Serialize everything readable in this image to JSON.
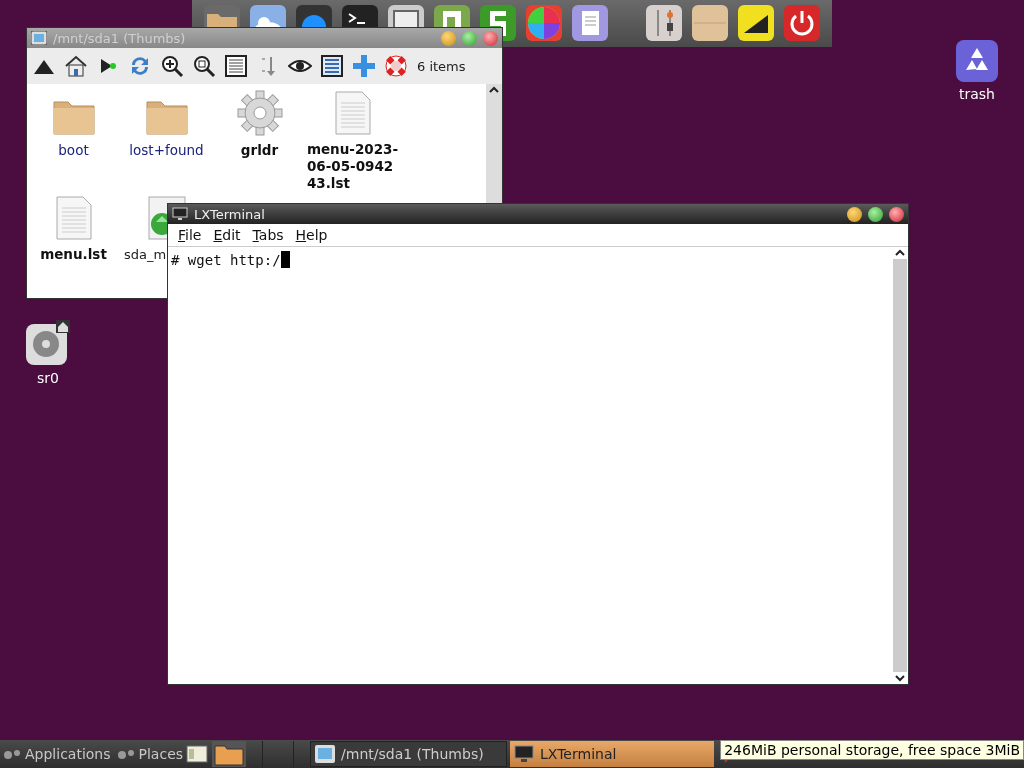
{
  "desktop_icons": [
    {
      "label": "trash",
      "kind": "trash"
    },
    {
      "label": "sr0",
      "kind": "drive"
    }
  ],
  "file_manager": {
    "title": "/mnt/sda1 (Thumbs)",
    "active": false,
    "status": "6 items",
    "files": [
      {
        "name": "boot",
        "kind": "folder"
      },
      {
        "name": "lost+found",
        "kind": "folder"
      },
      {
        "name": "grldr",
        "kind": "binary"
      },
      {
        "name": "menu-2023-\n06-05-0942\n43.lst",
        "kind": "text"
      },
      {
        "name": "menu.lst",
        "kind": "text"
      },
      {
        "name": "sda_m",
        "kind": "script"
      }
    ]
  },
  "terminal": {
    "title": "LXTerminal",
    "active": true,
    "menu": [
      {
        "label": "File"
      },
      {
        "label": "Edit"
      },
      {
        "label": "Tabs"
      },
      {
        "label": "Help"
      }
    ],
    "lines": [
      "# wget http:/"
    ]
  },
  "taskbar": {
    "launchers": [
      {
        "label": "Applications"
      },
      {
        "label": "Places"
      }
    ],
    "tasks": [
      {
        "label": "/mnt/sda1 (Thumbs)",
        "selected": false,
        "kind": "files"
      },
      {
        "label": "LXTerminal",
        "selected": true,
        "kind": "terminal"
      }
    ],
    "tooltip": "246MiB personal storage, free space 3MiB"
  }
}
